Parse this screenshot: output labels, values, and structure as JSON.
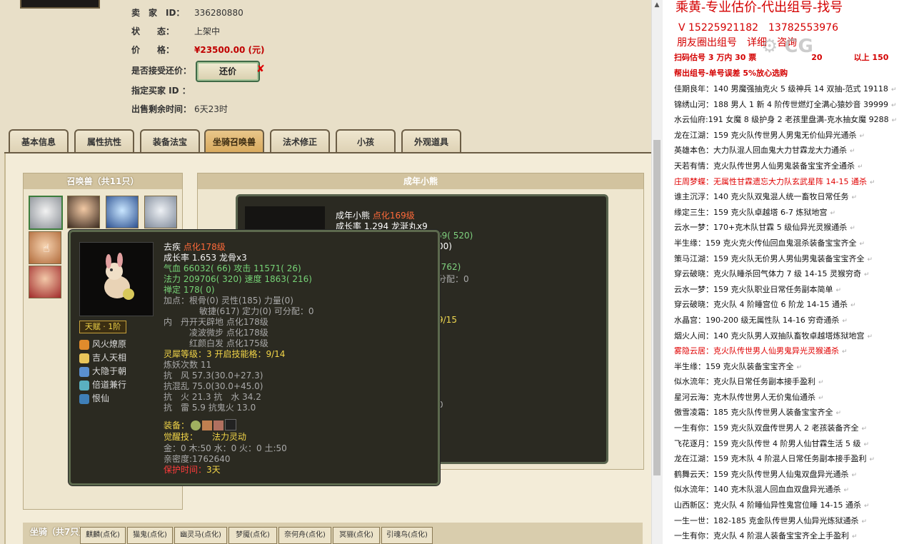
{
  "seller": {
    "seller_label": "卖　家　ID：",
    "seller_id": "336280880",
    "status_label": "状　　态：",
    "status": "上架中",
    "price_label": "价　　格：",
    "price": "¥23500.00 (元)",
    "counter_label": "是否接受还价：",
    "counter_button": "还价",
    "buyer_label": "指定买家 ID ：",
    "buyer_value": "",
    "remain_label": "出售剩余时间：",
    "remain": "6天23时"
  },
  "tabs": [
    "基本信息",
    "属性抗性",
    "装备法宝",
    "坐骑召唤兽",
    "法术修正",
    "小孩",
    "外观道具"
  ],
  "active_tab_index": 3,
  "summon_panel_title": "召唤兽（共11只）",
  "adult_panel_title": "成年小熊",
  "back_tooltip": {
    "name": "成年小熊",
    "level": "点化169级",
    "growth": "成长率 1.294 龙涎丸x9",
    "frag1": "69( 520)",
    "frag2": "00)",
    "frag3": "(762)",
    "frag4": "分配：0",
    "frag5": "9/15",
    "frag6": "0"
  },
  "tooltip": {
    "name": "去疾",
    "level": "点化178级",
    "growth": "成长率 1.653 龙骨x3",
    "hp": "气血 66032( 66) 攻击 11571( 26)",
    "mp": "法力 209706( 320) 速度 1863( 216)",
    "shen": "禅定 178( 0)",
    "points1": "加点：根骨(0) 灵性(185) 力量(0)",
    "points2": "敏捷(617) 定力(0) 可分配：0",
    "neidan_label": "内　丹",
    "neidan1": "开天辟地 点化178级",
    "neidan2": "凌波微步 点化178级",
    "neidan3": "红颜白发 点化175级",
    "spirit": "灵犀等级：3 开启技能格：9/14",
    "refine": "炼妖次数 11",
    "res1": "抗　风 57.3(30.0+27.3)",
    "res2": "抗混乱 75.0(30.0+45.0)",
    "res3": "抗　火 21.3 抗　水 34.2",
    "res4": "抗　雷 5.9 抗鬼火 13.0",
    "equip_label": "装备：",
    "awaken_label": "觉醒技：",
    "awaken": "法力灵动",
    "elements": "金：0 木:50 水：0 火：0 土:50",
    "intimacy": "亲密度:1762640",
    "protect_label": "保护时间：",
    "protect": "3天",
    "tianfu": "天赋 · 1阶",
    "skills": [
      "风火燎原",
      "吉人天相",
      "大隐于朝",
      "倍道兼行",
      "恨仙"
    ]
  },
  "mount_bar": {
    "title": "坐骑（共7只）",
    "tabs": [
      "麒麟(点化)",
      "猫鬼(点化)",
      "幽灵马(点化)",
      "梦魇(点化)",
      "奈何舟(点化)",
      "冥骊(点化)",
      "引魂鸟(点化)"
    ]
  },
  "right_panel": {
    "title": "乘黄-专业估价-代出组号-找号",
    "phone": "V 15225921182　13782553976",
    "friend": "朋友圈出组号　详细　咨询",
    "scan": "扫码估号 3 万内 30 票　　　　　　　20　　　　以上 150",
    "help": "帮出组号-单号误差 5%放心选购",
    "items": [
      {
        "text": "佳期良年：140 男魔强抽克火 5 级神兵 14 双抽-范式 19118",
        "hl": false
      },
      {
        "text": "锦绣山河：188 男人 1 新 4 阶传世燃灯全满心猿妙音 39999",
        "hl": false
      },
      {
        "text": "水云仙府:191 女魔 8 级护身 2 老孩里盘满-克水抽女魔 9288",
        "hl": false
      },
      {
        "text": "龙在江湖：159 克火队传世男人男鬼无价仙异光通杀",
        "hl": false
      },
      {
        "text": "英雄本色：大力队混人回血鬼大力甘霖龙大力通杀",
        "hl": false
      },
      {
        "text": "天若有情：克火队传世男人仙男鬼装备宝宝齐全通杀",
        "hl": false
      },
      {
        "text": "庄周梦蝶：无属性甘霖遗忘大力队玄武星阵 14-15 通杀",
        "hl": true
      },
      {
        "text": "谁主沉浮：140 克火队双鬼混人统一畜牧日常任务",
        "hl": false
      },
      {
        "text": "缘定三生：159 克火队卓越塔 6-7 炼狱地宫",
        "hl": false
      },
      {
        "text": "云水一梦：170+克木队甘霖 5 级仙异光灵猴通杀",
        "hl": false
      },
      {
        "text": "半生缘：159 克火克火传仙回血鬼混杀装备宝宝齐全",
        "hl": false
      },
      {
        "text": "策马江湖：159 克火队无价男人男仙男鬼装备宝宝齐全",
        "hl": false
      },
      {
        "text": "穿云破晓：克火队睡杀回气体力 7 级 14-15 灵猴穷奇",
        "hl": false
      },
      {
        "text": "云水一梦：159 克火队职业日常任务副本简单",
        "hl": false
      },
      {
        "text": "穿云破晓：克火队 4 阶睡宫位 6 阶龙 14-15 通杀",
        "hl": false
      },
      {
        "text": "水晶宫：190-200 级无属性队 14-16 穷奇通杀",
        "hl": false
      },
      {
        "text": "烟火人间：140 克火队男人双抽队畜牧卓越塔炼狱地宫",
        "hl": false
      },
      {
        "text": "雾隐云居：克火队传世男人仙男鬼异光灵猴通杀",
        "hl": true
      },
      {
        "text": "半生缘：159 克火队装备宝宝齐全",
        "hl": false
      },
      {
        "text": "似水流年：克火队日常任务副本接手盈利",
        "hl": false
      },
      {
        "text": "星河云海：克木队传世男人无价鬼仙通杀",
        "hl": false
      },
      {
        "text": "傲雪凌霜：185 克火队传世男人装备宝宝齐全",
        "hl": false
      },
      {
        "text": "一生有你：159 克火队双盘传世男人 2 老孩装备齐全",
        "hl": false
      },
      {
        "text": "飞花逐月：159 克火队传世 4 阶男人仙甘霖生活 5 级",
        "hl": false
      },
      {
        "text": "龙在江湖：159 克木队 4 阶混人日常任务副本接手盈利",
        "hl": false
      },
      {
        "text": "鹤舞云天：159 克火队传世男人仙鬼双盘异光通杀",
        "hl": false
      },
      {
        "text": "似水流年：140 克木队混人回血血双盘异光通杀",
        "hl": false
      },
      {
        "text": "山西新区：克火队 4 阶睡仙异性鬼宫位睡 14-15 通杀",
        "hl": false
      },
      {
        "text": "一生一世：182-185 克金队传世男人仙异光炼狱通杀",
        "hl": false
      },
      {
        "text": "一生有你：克火队 4 阶混人装备宝宝齐全上手盈利",
        "hl": false
      }
    ]
  },
  "colors": {
    "accent_red": "#d40000",
    "tooltip_bg": "#2b2a21",
    "tab_active": "#d8a95c"
  }
}
